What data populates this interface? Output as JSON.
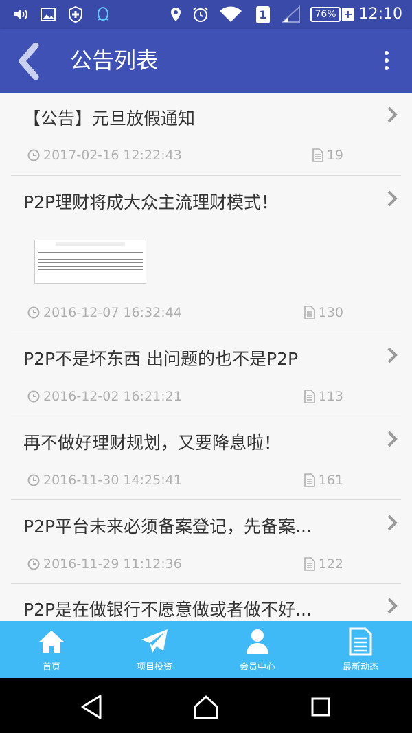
{
  "status_bar": {
    "time": "12:10",
    "battery": "76%",
    "sim_slot": "1",
    "icons": [
      "volume-icon",
      "image-icon",
      "shield-icon",
      "qq-icon",
      "location-icon",
      "alarm-icon",
      "wifi-icon",
      "signal-icon"
    ]
  },
  "app_bar": {
    "title": "公告列表",
    "back_icon": "chevron-left-icon",
    "menu_icon": "more-vert-icon"
  },
  "list": {
    "items": [
      {
        "title": "【公告】元旦放假通知",
        "time": "2017-02-16 12:22:43",
        "count": "19",
        "has_image": false
      },
      {
        "title": "P2P理财将成大众主流理财模式！",
        "time": "2016-12-07 16:32:44",
        "count": "130",
        "has_image": true
      },
      {
        "title": "P2P不是坏东西 出问题的也不是P2P",
        "time": "2016-12-02 16:21:21",
        "count": "113",
        "has_image": false
      },
      {
        "title": "再不做好理财规划，又要降息啦！",
        "time": "2016-11-30 14:25:41",
        "count": "161",
        "has_image": false
      },
      {
        "title": "P2P平台未来必须备案登记，先备案...",
        "time": "2016-11-29 11:12:36",
        "count": "122",
        "has_image": false
      },
      {
        "title": "P2P是在做银行不愿意做或者做不好...",
        "time": "",
        "count": "",
        "has_image": false
      }
    ]
  },
  "bottom_nav": {
    "items": [
      {
        "label": "首页",
        "icon": "home-icon"
      },
      {
        "label": "项目投资",
        "icon": "paper-plane-icon"
      },
      {
        "label": "会员中心",
        "icon": "user-icon"
      },
      {
        "label": "最新动态",
        "icon": "document-icon"
      }
    ]
  },
  "system_nav": {
    "buttons": [
      "back-triangle-icon",
      "home-circle-icon",
      "recents-square-icon"
    ]
  },
  "colors": {
    "status_bar": "#3a4aa8",
    "app_bar": "#3f51b5",
    "bottom_nav": "#3fbaf6",
    "list_bg": "#f7f7f7",
    "meta_text": "#b0b0b0"
  }
}
